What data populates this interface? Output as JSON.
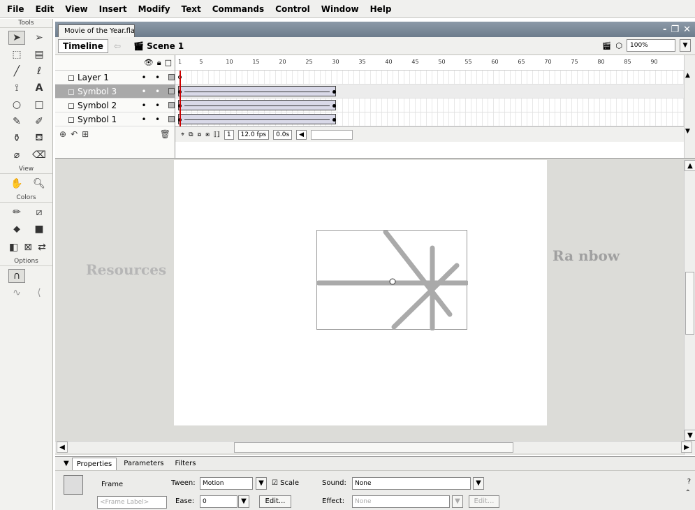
{
  "menu": [
    "File",
    "Edit",
    "View",
    "Insert",
    "Modify",
    "Text",
    "Commands",
    "Control",
    "Window",
    "Help"
  ],
  "tools": {
    "title": "Tools",
    "view_title": "View",
    "colors_title": "Colors",
    "options_title": "Options"
  },
  "document": {
    "tab_title": "Movie of the Year.fla*",
    "window_controls": [
      "-",
      "❐",
      "✕"
    ],
    "timeline_label": "Timeline",
    "scene_label": "Scene 1",
    "zoom": "100%"
  },
  "timeline": {
    "ruler_numbers": [
      "1",
      "5",
      "10",
      "15",
      "20",
      "25",
      "30",
      "35",
      "40",
      "45",
      "50",
      "55",
      "60",
      "65",
      "70",
      "75",
      "80",
      "85",
      "90"
    ],
    "layers": [
      {
        "name": "Layer 1",
        "selected": false
      },
      {
        "name": "Symbol 3",
        "selected": true
      },
      {
        "name": "Symbol 2",
        "selected": false
      },
      {
        "name": "Symbol 1",
        "selected": false
      }
    ],
    "current_frame": "1",
    "fps": "12.0 fps",
    "time": "0.0s"
  },
  "stage": {
    "left_text": "Resources",
    "right_text": "Ra nbow"
  },
  "properties": {
    "tabs": [
      "Properties",
      "Parameters",
      "Filters"
    ],
    "frame_label": "Frame",
    "frame_placeholder": "<Frame Label>",
    "tween_label": "Tween:",
    "tween_value": "Motion",
    "scale_label": "Scale",
    "ease_label": "Ease:",
    "ease_value": "0",
    "edit_label": "Edit...",
    "sound_label": "Sound:",
    "sound_value": "None",
    "effect_label": "Effect:",
    "effect_value": "None",
    "effect_edit_label": "Edit..."
  },
  "colors": {
    "stage_bg": "#ffffff",
    "workspace": "#dcdcd8",
    "selected_layer": "#a9a9a9",
    "symbol_stroke": "#aaaaaa"
  }
}
